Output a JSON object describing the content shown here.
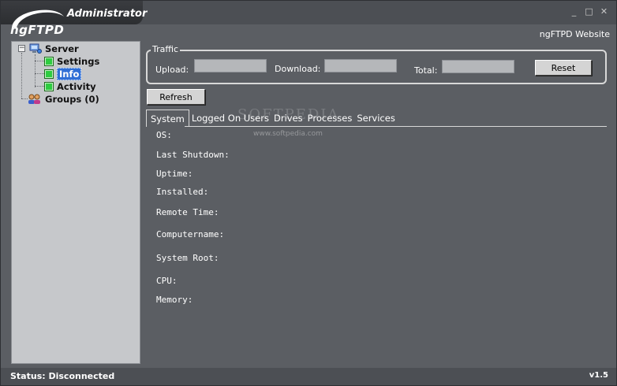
{
  "app": {
    "logo_text": "ngFTPD",
    "role": "Administrator",
    "website_link": "ngFTPD Website",
    "window_buttons": {
      "minimize": "_",
      "maximize": "□",
      "close": "✕"
    }
  },
  "sidebar": {
    "tree": [
      {
        "label": "Server",
        "icon": "server-icon",
        "expanded": true
      },
      {
        "label": "Settings",
        "icon": "green-square-icon"
      },
      {
        "label": "Info",
        "icon": "green-square-icon",
        "selected": true
      },
      {
        "label": "Activity",
        "icon": "green-square-icon"
      },
      {
        "label": "Groups (0)",
        "icon": "users-icon"
      }
    ]
  },
  "traffic": {
    "legend": "Traffic",
    "upload_label": "Upload:",
    "download_label": "Download:",
    "total_label": "Total:",
    "upload_value": "",
    "download_value": "",
    "total_value": "",
    "reset_label": "Reset"
  },
  "refresh_label": "Refresh",
  "tabs": [
    "System",
    "Logged On Users",
    "Drives",
    "Processes",
    "Services"
  ],
  "active_tab": "System",
  "watermark": {
    "text": "SOFTPEDIA",
    "url": "www.softpedia.com"
  },
  "system_info": {
    "labels": [
      "OS:",
      "Last Shutdown:",
      "Uptime:",
      "Installed:",
      "Remote Time:",
      "Computername:",
      "System Root:",
      "CPU:",
      "Memory:"
    ]
  },
  "status": {
    "text": "Status: Disconnected",
    "version": "v1.5"
  },
  "colors": {
    "window_bg": "#5b5e63",
    "sidebar_bg": "#c6c8cb",
    "selection": "#2f6fd6",
    "tree_icon_green": "#2ecc40"
  }
}
